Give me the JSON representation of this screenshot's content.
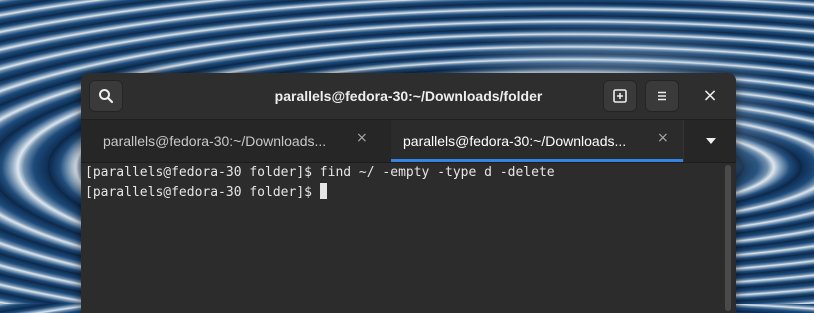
{
  "window": {
    "title": "parallels@fedora-30:~/Downloads/folder",
    "close_glyph": "×"
  },
  "headerbar": {
    "search_icon": "search-icon",
    "new_tab_icon": "new-tab-icon",
    "menu_icon": "hamburger-menu-icon"
  },
  "tabs": [
    {
      "label": "parallels@fedora-30:~/Downloads...",
      "close": "×",
      "active": false
    },
    {
      "label": "parallels@fedora-30:~/Downloads...",
      "close": "×",
      "active": true
    }
  ],
  "terminal": {
    "lines": [
      "[parallels@fedora-30 folder]$ find ~/ -empty -type d -delete",
      "[parallels@fedora-30 folder]$ "
    ]
  },
  "colors": {
    "accent": "#3584e4",
    "window_bg": "#2b2b2b",
    "text": "#eeeeec"
  }
}
